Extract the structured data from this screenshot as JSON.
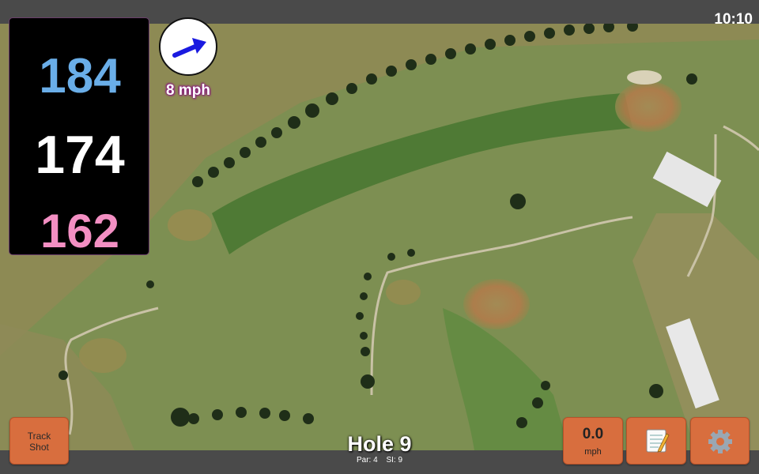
{
  "status": {
    "time": "10:10"
  },
  "distances": {
    "back": "184",
    "middle": "174",
    "front": "162"
  },
  "wind": {
    "speed": "8 mph",
    "arrow_color": "#1a1ae0"
  },
  "hole": {
    "title": "Hole 9",
    "par": "Par: 4",
    "si": "SI: 9"
  },
  "buttons": {
    "track_shot": [
      "Track",
      "Shot"
    ],
    "speed_value": "0.0",
    "speed_unit": "mph",
    "notes_icon": "notepad-icon",
    "settings_icon": "gear-icon"
  },
  "colors": {
    "back": "#6aaee8",
    "middle": "#ffffff",
    "front": "#f38fc3",
    "button": "#d86e3e",
    "wind_label_glow": "#8a1e7d"
  }
}
